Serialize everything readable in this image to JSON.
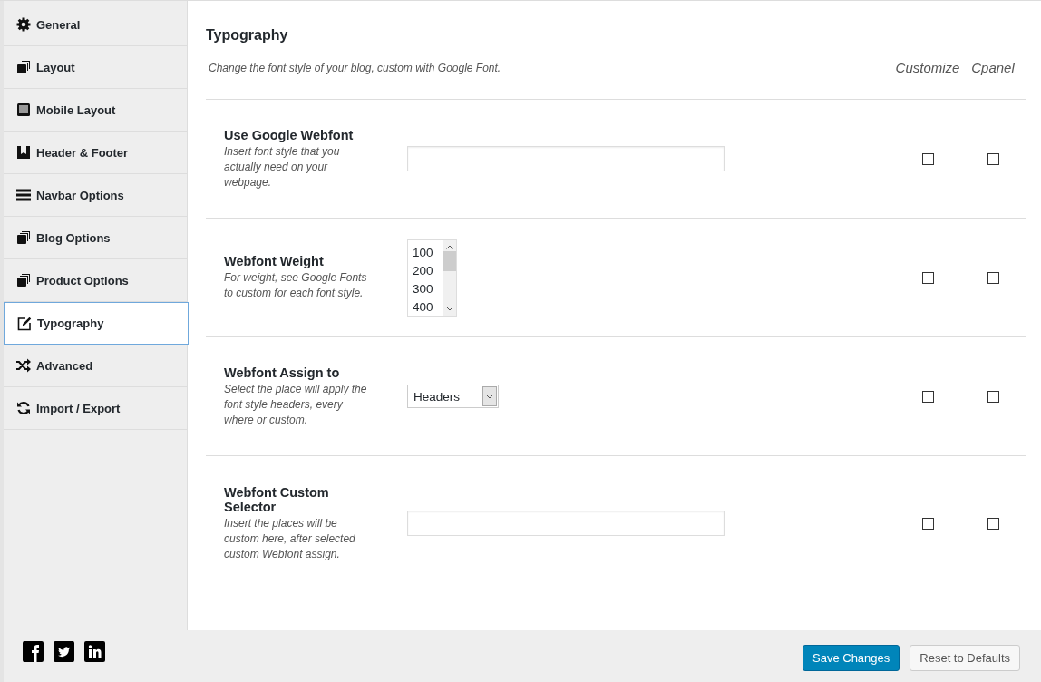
{
  "sidebar": {
    "items": [
      {
        "label": "General",
        "selected": false
      },
      {
        "label": "Layout",
        "selected": false
      },
      {
        "label": "Mobile Layout",
        "selected": false
      },
      {
        "label": "Header & Footer",
        "selected": false
      },
      {
        "label": "Navbar Options",
        "selected": false
      },
      {
        "label": "Blog Options",
        "selected": false
      },
      {
        "label": "Product Options",
        "selected": false
      },
      {
        "label": "Typography",
        "selected": true
      },
      {
        "label": "Advanced",
        "selected": false
      },
      {
        "label": "Import / Export",
        "selected": false
      }
    ]
  },
  "section": {
    "title": "Typography",
    "description": "Change the font style of your blog, custom with Google Font.",
    "columns": [
      "Customize",
      "Cpanel"
    ]
  },
  "options": [
    {
      "kind": "text",
      "label": "Use Google Webfont",
      "help": "Insert font style that you actually need on your webpage.",
      "customize": false,
      "cpanel": false
    },
    {
      "kind": "multiselect",
      "label": "Webfont Weight",
      "help": "For weight, see Google Fonts to custom for each font style.",
      "options": [
        "100",
        "200",
        "300",
        "400"
      ],
      "customize": false,
      "cpanel": false
    },
    {
      "kind": "select",
      "label": "Webfont Assign to",
      "help": "Select the place will apply the font style headers, every where or custom.",
      "value": "Headers",
      "customize": false,
      "cpanel": false
    },
    {
      "kind": "text",
      "label": "Webfont Custom Selector",
      "help": "Insert the places will be custom here, after selected custom Webfont assign.",
      "customize": false,
      "cpanel": false
    }
  ],
  "footer": {
    "buttons": [
      {
        "label": "Save Changes",
        "kind": "primary"
      },
      {
        "label": "Reset to Defaults",
        "kind": "secondary"
      }
    ]
  }
}
